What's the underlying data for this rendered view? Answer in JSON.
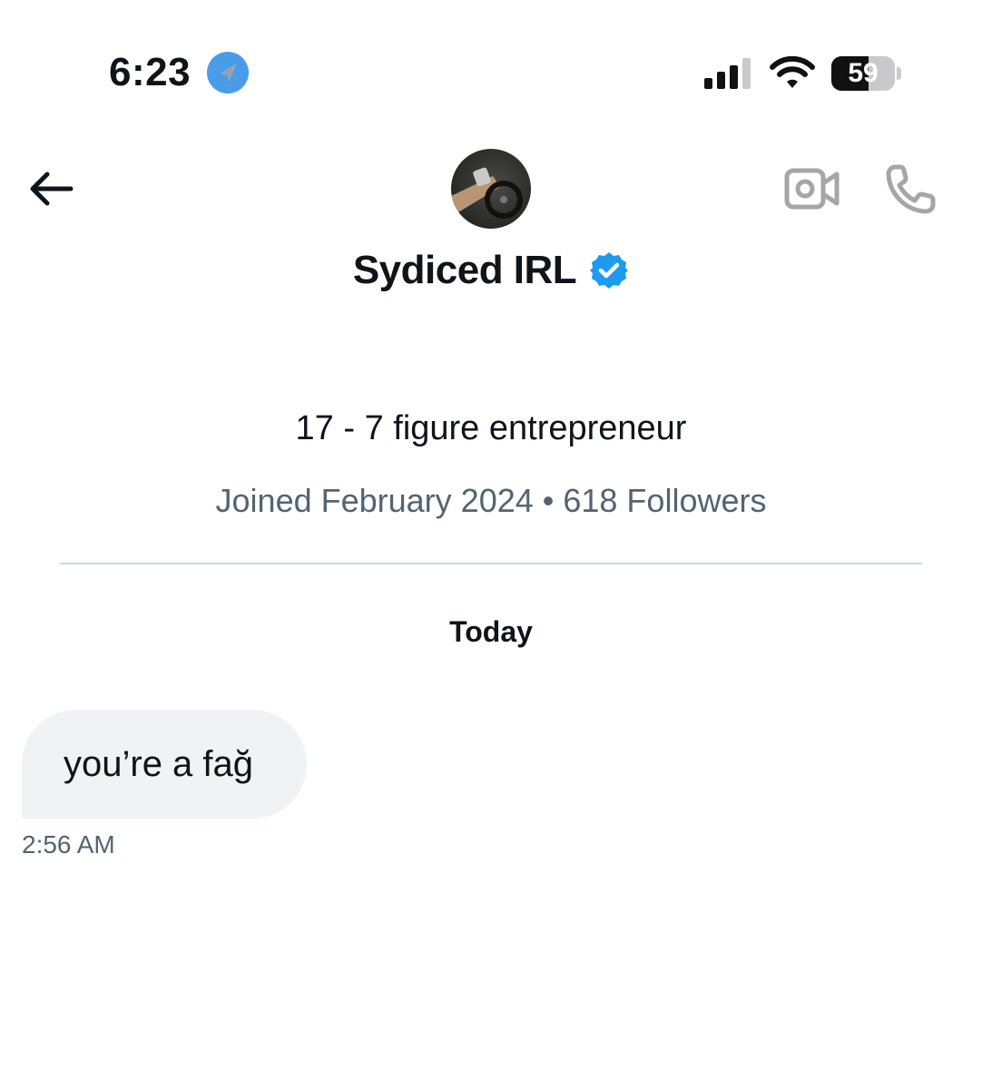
{
  "status_bar": {
    "time": "6:23",
    "location_icon": "location-arrow-icon",
    "signal_icon": "cellular-signal-icon",
    "wifi_icon": "wifi-icon",
    "battery_percent": "59",
    "battery_level": 0.59
  },
  "header": {
    "back_icon": "arrow-left-icon",
    "video_icon": "video-camera-icon",
    "phone_icon": "phone-icon",
    "verified_icon": "verified-badge-icon",
    "verified_color": "#1d9bf0"
  },
  "profile": {
    "name": "Sydiced IRL",
    "bio": "17 - 7 figure entrepreneur",
    "meta": "Joined February 2024 • 618 Followers"
  },
  "conversation": {
    "day_label": "Today",
    "messages": [
      {
        "text": "you’re a fağ",
        "time": "2:56 AM"
      }
    ]
  },
  "colors": {
    "text_primary": "#0f1419",
    "text_secondary": "#536471",
    "bubble_bg": "#eff3f4",
    "divider": "#cfd9de",
    "icon_gray": "#a6a6a6",
    "location_blue": "#4a9ce9"
  }
}
